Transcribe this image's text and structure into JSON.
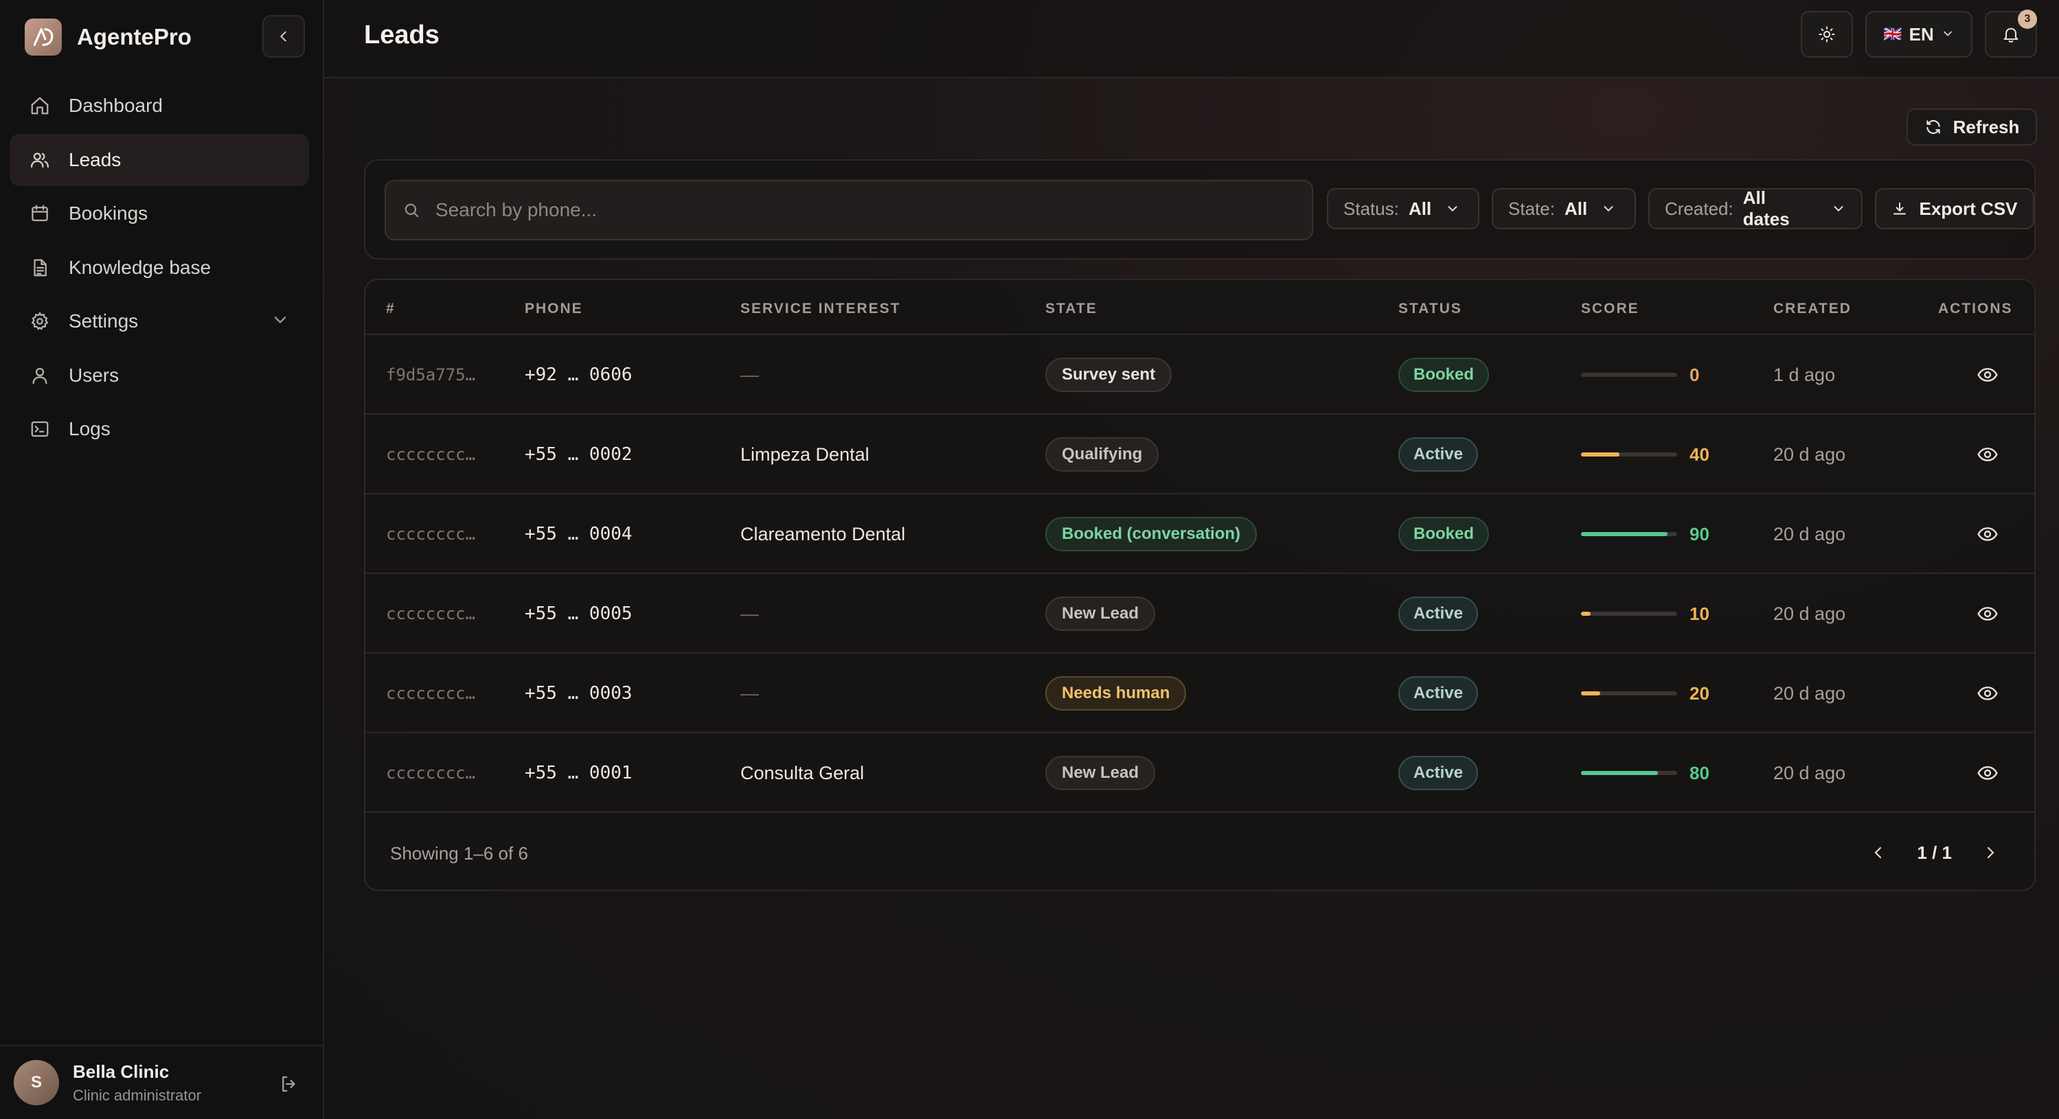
{
  "app": {
    "name": "AgentePro",
    "logo_text": "A"
  },
  "sidebar": {
    "items": [
      {
        "label": "Dashboard",
        "icon": "home-icon",
        "active": false
      },
      {
        "label": "Leads",
        "icon": "users-icon",
        "active": true
      },
      {
        "label": "Bookings",
        "icon": "calendar-icon",
        "active": false
      },
      {
        "label": "Knowledge base",
        "icon": "document-icon",
        "active": false
      },
      {
        "label": "Settings",
        "icon": "gear-icon",
        "active": false,
        "expandable": true
      },
      {
        "label": "Users",
        "icon": "user-icon",
        "active": false
      },
      {
        "label": "Logs",
        "icon": "terminal-icon",
        "active": false
      }
    ],
    "user": {
      "initial": "S",
      "name": "Bella Clinic",
      "role": "Clinic administrator"
    }
  },
  "header": {
    "title": "Leads",
    "language": {
      "flag": "🇬🇧",
      "code": "EN"
    },
    "notifications_count": "3"
  },
  "toolbar": {
    "refresh_label": "Refresh"
  },
  "filters": {
    "search_placeholder": "Search by phone...",
    "search_value": "",
    "status": {
      "key": "Status:",
      "value": "All"
    },
    "state": {
      "key": "State:",
      "value": "All"
    },
    "created": {
      "key": "Created:",
      "value": "All dates"
    },
    "export_label": "Export CSV"
  },
  "table": {
    "columns": [
      "#",
      "PHONE",
      "SERVICE INTEREST",
      "STATE",
      "STATUS",
      "SCORE",
      "CREATED",
      "ACTIONS"
    ],
    "rows": [
      {
        "id": "f9d5a775…",
        "phone": "+92 … 0606",
        "service": "—",
        "state": "Survey sent",
        "status": "Booked",
        "score": 0,
        "score_label": "0",
        "created": "1 d ago"
      },
      {
        "id": "cccccccc…",
        "phone": "+55 … 0002",
        "service": "Limpeza Dental",
        "state": "Qualifying",
        "status": "Active",
        "score": 40,
        "score_label": "40",
        "created": "20 d ago"
      },
      {
        "id": "cccccccc…",
        "phone": "+55 … 0004",
        "service": "Clareamento Dental",
        "state": "Booked (conversation)",
        "status": "Booked",
        "score": 90,
        "score_label": "90",
        "created": "20 d ago"
      },
      {
        "id": "cccccccc…",
        "phone": "+55 … 0005",
        "service": "—",
        "state": "New Lead",
        "status": "Active",
        "score": 10,
        "score_label": "10",
        "created": "20 d ago"
      },
      {
        "id": "cccccccc…",
        "phone": "+55 … 0003",
        "service": "—",
        "state": "Needs human",
        "status": "Active",
        "score": 20,
        "score_label": "20",
        "created": "20 d ago"
      },
      {
        "id": "cccccccc…",
        "phone": "+55 … 0001",
        "service": "Consulta Geral",
        "state": "New Lead",
        "status": "Active",
        "score": 80,
        "score_label": "80",
        "created": "20 d ago"
      }
    ],
    "showing": "Showing 1–6 of 6",
    "page": "1 / 1"
  },
  "colors": {
    "score_low": "#f0b456",
    "score_high": "#56c98e",
    "score_zero": "#e3a567",
    "accent": "#d9b99f"
  }
}
